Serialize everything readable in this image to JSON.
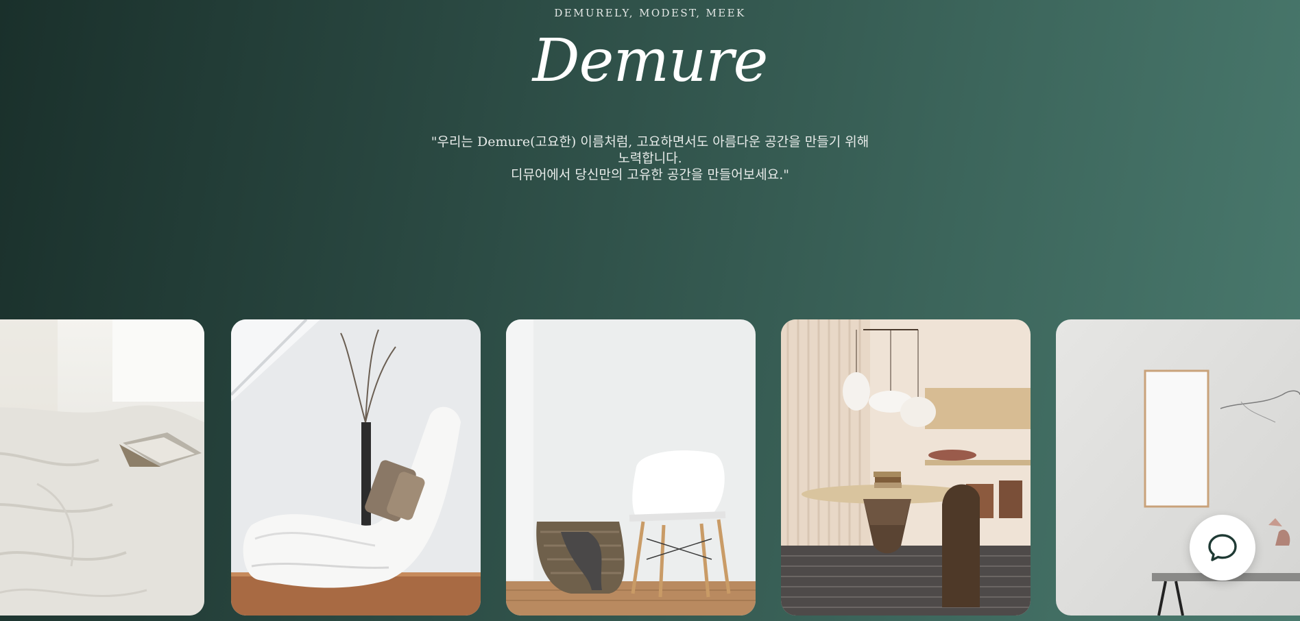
{
  "hero": {
    "tagline": "DEMURELY, MODEST, MEEK",
    "brand": "Demure",
    "description_lines": [
      "\"우리는 Demure(고요한) 이름처럼, 고요하면서도 아름다운 공간을 만들기 위해",
      "노력합니다.",
      "디뮤어에서 당신만의 고유한 공간을 만들어보세요.\""
    ]
  },
  "gallery": {
    "images": [
      {
        "subject": "white bedding with open book"
      },
      {
        "subject": "white chaise lounge with vase and cushions"
      },
      {
        "subject": "white chair with woven basket"
      },
      {
        "subject": "dining table with pendant lamps"
      },
      {
        "subject": "concrete wall with framed mirror and console"
      }
    ]
  },
  "chat": {
    "icon": "chat-bubble-icon"
  },
  "colors": {
    "background_dark": "#1a302b",
    "background_light": "#4a7a6e",
    "text": "#e8ecea",
    "chat_icon": "#1f3a34"
  }
}
